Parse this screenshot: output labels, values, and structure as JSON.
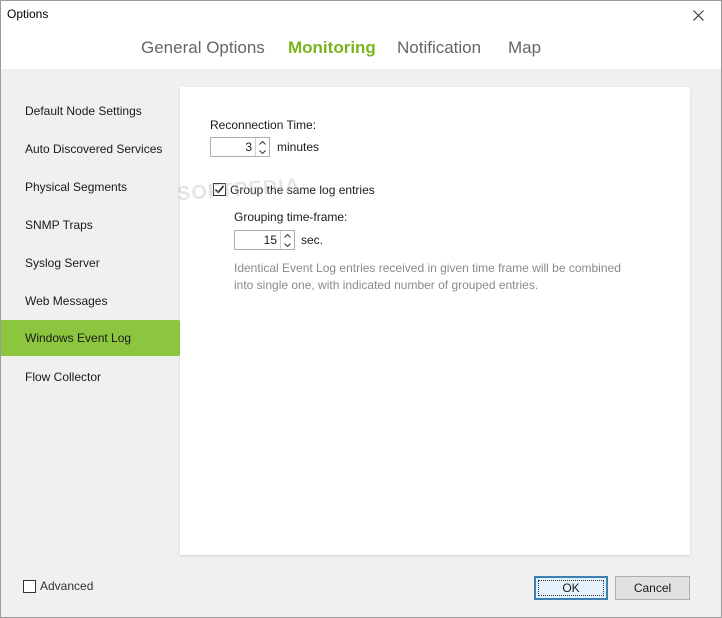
{
  "window": {
    "title": "Options"
  },
  "tabs": [
    {
      "label": "General Options",
      "active": false
    },
    {
      "label": "Monitoring",
      "active": true
    },
    {
      "label": "Notification",
      "active": false
    },
    {
      "label": "Map",
      "active": false
    }
  ],
  "sidebar": {
    "items": [
      {
        "label": "Default Node Settings"
      },
      {
        "label": "Auto Discovered Services"
      },
      {
        "label": "Physical Segments"
      },
      {
        "label": "SNMP Traps"
      },
      {
        "label": "Syslog Server"
      },
      {
        "label": "Web Messages"
      },
      {
        "label": "Windows Event Log"
      },
      {
        "label": "Flow Collector"
      }
    ],
    "selected": "Windows Event Log"
  },
  "settings": {
    "reconnection_label": "Reconnection Time:",
    "reconnection_value": "3",
    "reconnection_unit": "minutes",
    "group_label": "Group the same log entries",
    "group_checked": true,
    "grouping_label": "Grouping time-frame:",
    "grouping_value": "15",
    "grouping_unit": "sec.",
    "description_line1": "Identical Event Log entries received in given time frame will be combined",
    "description_line2": "into single one, with indicated number of grouped entries."
  },
  "footer": {
    "advanced_label": "Advanced",
    "advanced_checked": false,
    "ok_label": "OK",
    "cancel_label": "Cancel"
  },
  "watermark": "SOFTPEDIA",
  "colors": {
    "accent": "#7ab51d",
    "selected_bg": "#8cc63f",
    "panel_bg": "#f0f0f0",
    "description_text": "#8a8a8a"
  },
  "icons": {
    "close": "close-icon",
    "spin_up": "chevron-up-icon",
    "spin_down": "chevron-down-icon",
    "checkmark": "checkmark-icon"
  }
}
